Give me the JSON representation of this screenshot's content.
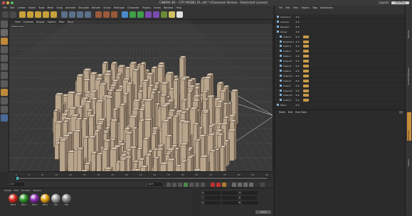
{
  "window": {
    "title": "CINEMA 4D – CITY MODEL 01.c4d * (Classroom Version – Restricted License)",
    "layout_label": "Layout:",
    "layout_value": "Startup"
  },
  "menubar": [
    "File",
    "Edit",
    "Create",
    "Select",
    "Tools",
    "Mesh",
    "Snap",
    "Animate",
    "Simulate",
    "Render",
    "Sculpt",
    "MoGraph",
    "Character",
    "Plugins",
    "Script",
    "Window",
    "Help"
  ],
  "viewport": {
    "menu": [
      "View",
      "Cameras",
      "Display",
      "Options",
      "Filter",
      "Panel"
    ],
    "label": "Perspective"
  },
  "timeline": {
    "ticks": [
      "0",
      "5",
      "10",
      "15",
      "20",
      "25",
      "30",
      "35",
      "40",
      "45",
      "50",
      "55",
      "60",
      "65",
      "70",
      "75",
      "80",
      "85",
      "90"
    ],
    "current_frame": "0 F",
    "end_frame": "90 F"
  },
  "material_panel": {
    "menu": [
      "Create",
      "Edit",
      "Function",
      "Texture"
    ],
    "materials": [
      {
        "name": "Mat.4",
        "color": "#d62b1e"
      },
      {
        "name": "Mat.3",
        "color": "#2f9a2a"
      },
      {
        "name": "Mat.2",
        "color": "#8a2fb0"
      },
      {
        "name": "Mat.1",
        "color": "#e0a010"
      },
      {
        "name": "Mat",
        "color": "#9a9a9a"
      },
      {
        "name": "Mat",
        "color": "#8a8a8a"
      }
    ]
  },
  "coordinates": {
    "labels": [
      "X",
      "Y",
      "Z"
    ],
    "columns": [
      "H",
      "P",
      "B"
    ],
    "apply_label": "Apply"
  },
  "object_manager": {
    "menu": [
      "File",
      "Edit",
      "View",
      "Objects",
      "Tags",
      "Bookmarks"
    ],
    "objects": [
      {
        "name": "Camera.1",
        "indent": 0
      },
      {
        "name": "Camera",
        "indent": 0
      },
      {
        "name": "Random",
        "indent": 0
      },
      {
        "name": "Cloner",
        "indent": 0
      },
      {
        "name": "Cube.4",
        "indent": 1
      },
      {
        "name": "Pyramid.1",
        "indent": 1
      },
      {
        "name": "Cube.3",
        "indent": 1
      },
      {
        "name": "Cube.2",
        "indent": 1
      },
      {
        "name": "Cube.1",
        "indent": 1
      },
      {
        "name": "Cube.11",
        "indent": 1
      },
      {
        "name": "Cube.8",
        "indent": 1
      },
      {
        "name": "Cube.9",
        "indent": 1
      },
      {
        "name": "Cube.10",
        "indent": 1
      },
      {
        "name": "Cube.6",
        "indent": 1
      },
      {
        "name": "Cube.7",
        "indent": 1
      },
      {
        "name": "Cube.12",
        "indent": 1
      },
      {
        "name": "Cube.13",
        "indent": 1
      },
      {
        "name": "Cube.5",
        "indent": 1
      },
      {
        "name": "Plane",
        "indent": 0
      }
    ]
  },
  "attribute_manager": {
    "menu": [
      "Mode",
      "Edit",
      "User Data"
    ]
  },
  "side_tabs": [
    "Objects",
    "Content Browser",
    "Attributes",
    "Layers"
  ]
}
